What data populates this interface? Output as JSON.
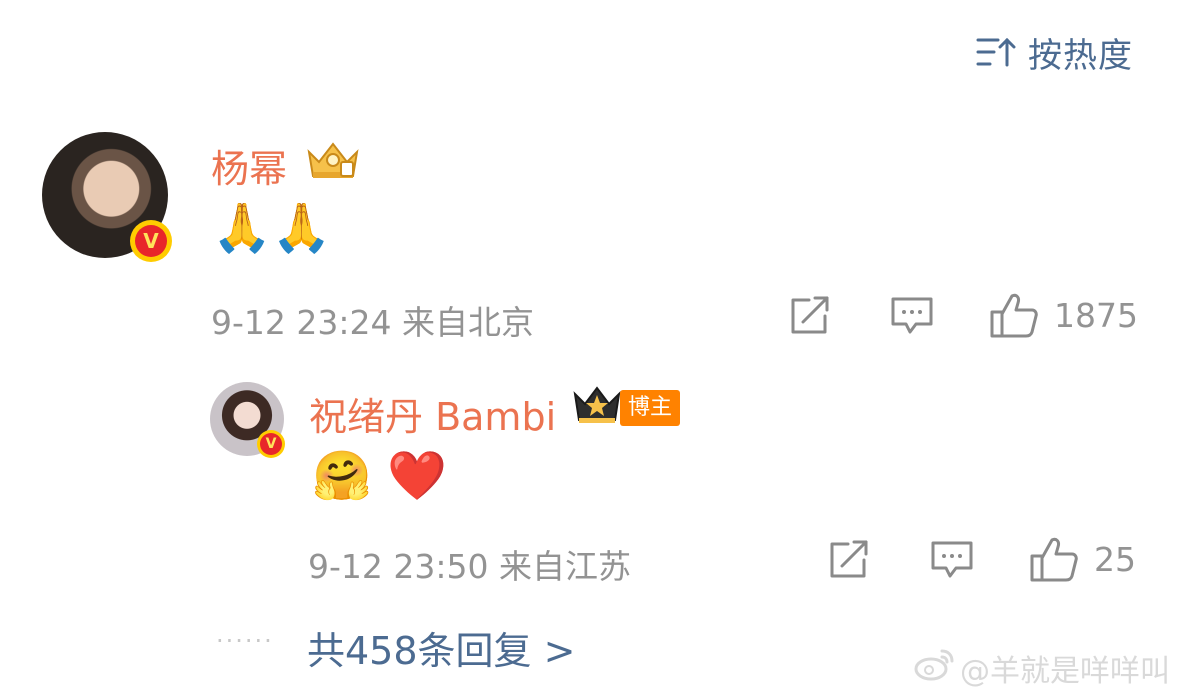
{
  "sort": {
    "label": "按热度"
  },
  "comment": {
    "username": "杨幂",
    "verified_mark": "V",
    "content": "🙏🙏",
    "time": "9-12 23:24",
    "location": "来自北京",
    "likes": "1875",
    "reply": {
      "username": "祝绪丹 Bambi",
      "verified_mark": "V",
      "role_badge": "博主",
      "content": "🤗 ❤️",
      "time": "9-12 23:50",
      "location": "来自江苏",
      "likes": "25"
    }
  },
  "more_replies": {
    "dots": "......",
    "label": "共458条回复 >"
  },
  "watermark": {
    "text": "@羊就是咩咩叫"
  },
  "colors": {
    "username": "#eb7350",
    "link": "#4c6b91",
    "meta": "#939393",
    "role_badge": "#ff8200"
  },
  "icons": [
    "sort-icon",
    "crown-badge-icon",
    "verified-icon",
    "share-icon",
    "comment-icon",
    "like-icon",
    "weibo-logo-icon"
  ]
}
